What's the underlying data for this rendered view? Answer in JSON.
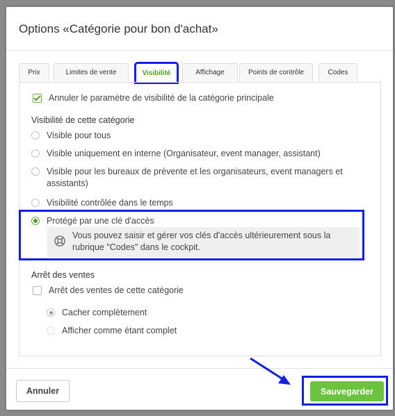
{
  "dialog": {
    "title": "Options «Catégorie pour bon d'achat»"
  },
  "tabs": [
    {
      "label": "Prix",
      "active": false
    },
    {
      "label": "Limites de vente",
      "active": false
    },
    {
      "label": "Visibilité",
      "active": true
    },
    {
      "label": "Affichage",
      "active": false
    },
    {
      "label": "Points de contrôle",
      "active": false
    },
    {
      "label": "Codes",
      "active": false
    }
  ],
  "visibility": {
    "override_parent_label": "Annuler le paramètre de visibilité de la catégorie principale",
    "override_parent_checked": true,
    "section_title": "Visibilité de cette catégorie",
    "options": [
      {
        "label": "Visible pour tous",
        "selected": false
      },
      {
        "label": "Visible uniquement en interne (Organisateur, event manager, assistant)",
        "selected": false
      },
      {
        "label": "Visible pour les bureaux de prévente et les organisateurs, event managers et assistants)",
        "selected": false
      },
      {
        "label": "Visibilité contrôlée dans le temps",
        "selected": false
      },
      {
        "label": "Protégé par une clé d'accès",
        "selected": true
      }
    ],
    "info_text": "Vous pouvez saisir et gérer vos clés d'accès ultérieurement sous la rubrique \"Codes\" dans le cockpit."
  },
  "sales_stop": {
    "section_title": "Arrêt des ventes",
    "checkbox_label": "Arrêt des ventes de cette catégorie",
    "checked": false,
    "options": [
      {
        "label": "Cacher complètement",
        "selected": true
      },
      {
        "label": "Afficher comme étant complet",
        "selected": false
      }
    ]
  },
  "footer": {
    "cancel_label": "Annuler",
    "save_label": "Sauvegarder"
  },
  "colors": {
    "accent_green": "#6cc33f",
    "highlight_blue": "#1220e0"
  }
}
